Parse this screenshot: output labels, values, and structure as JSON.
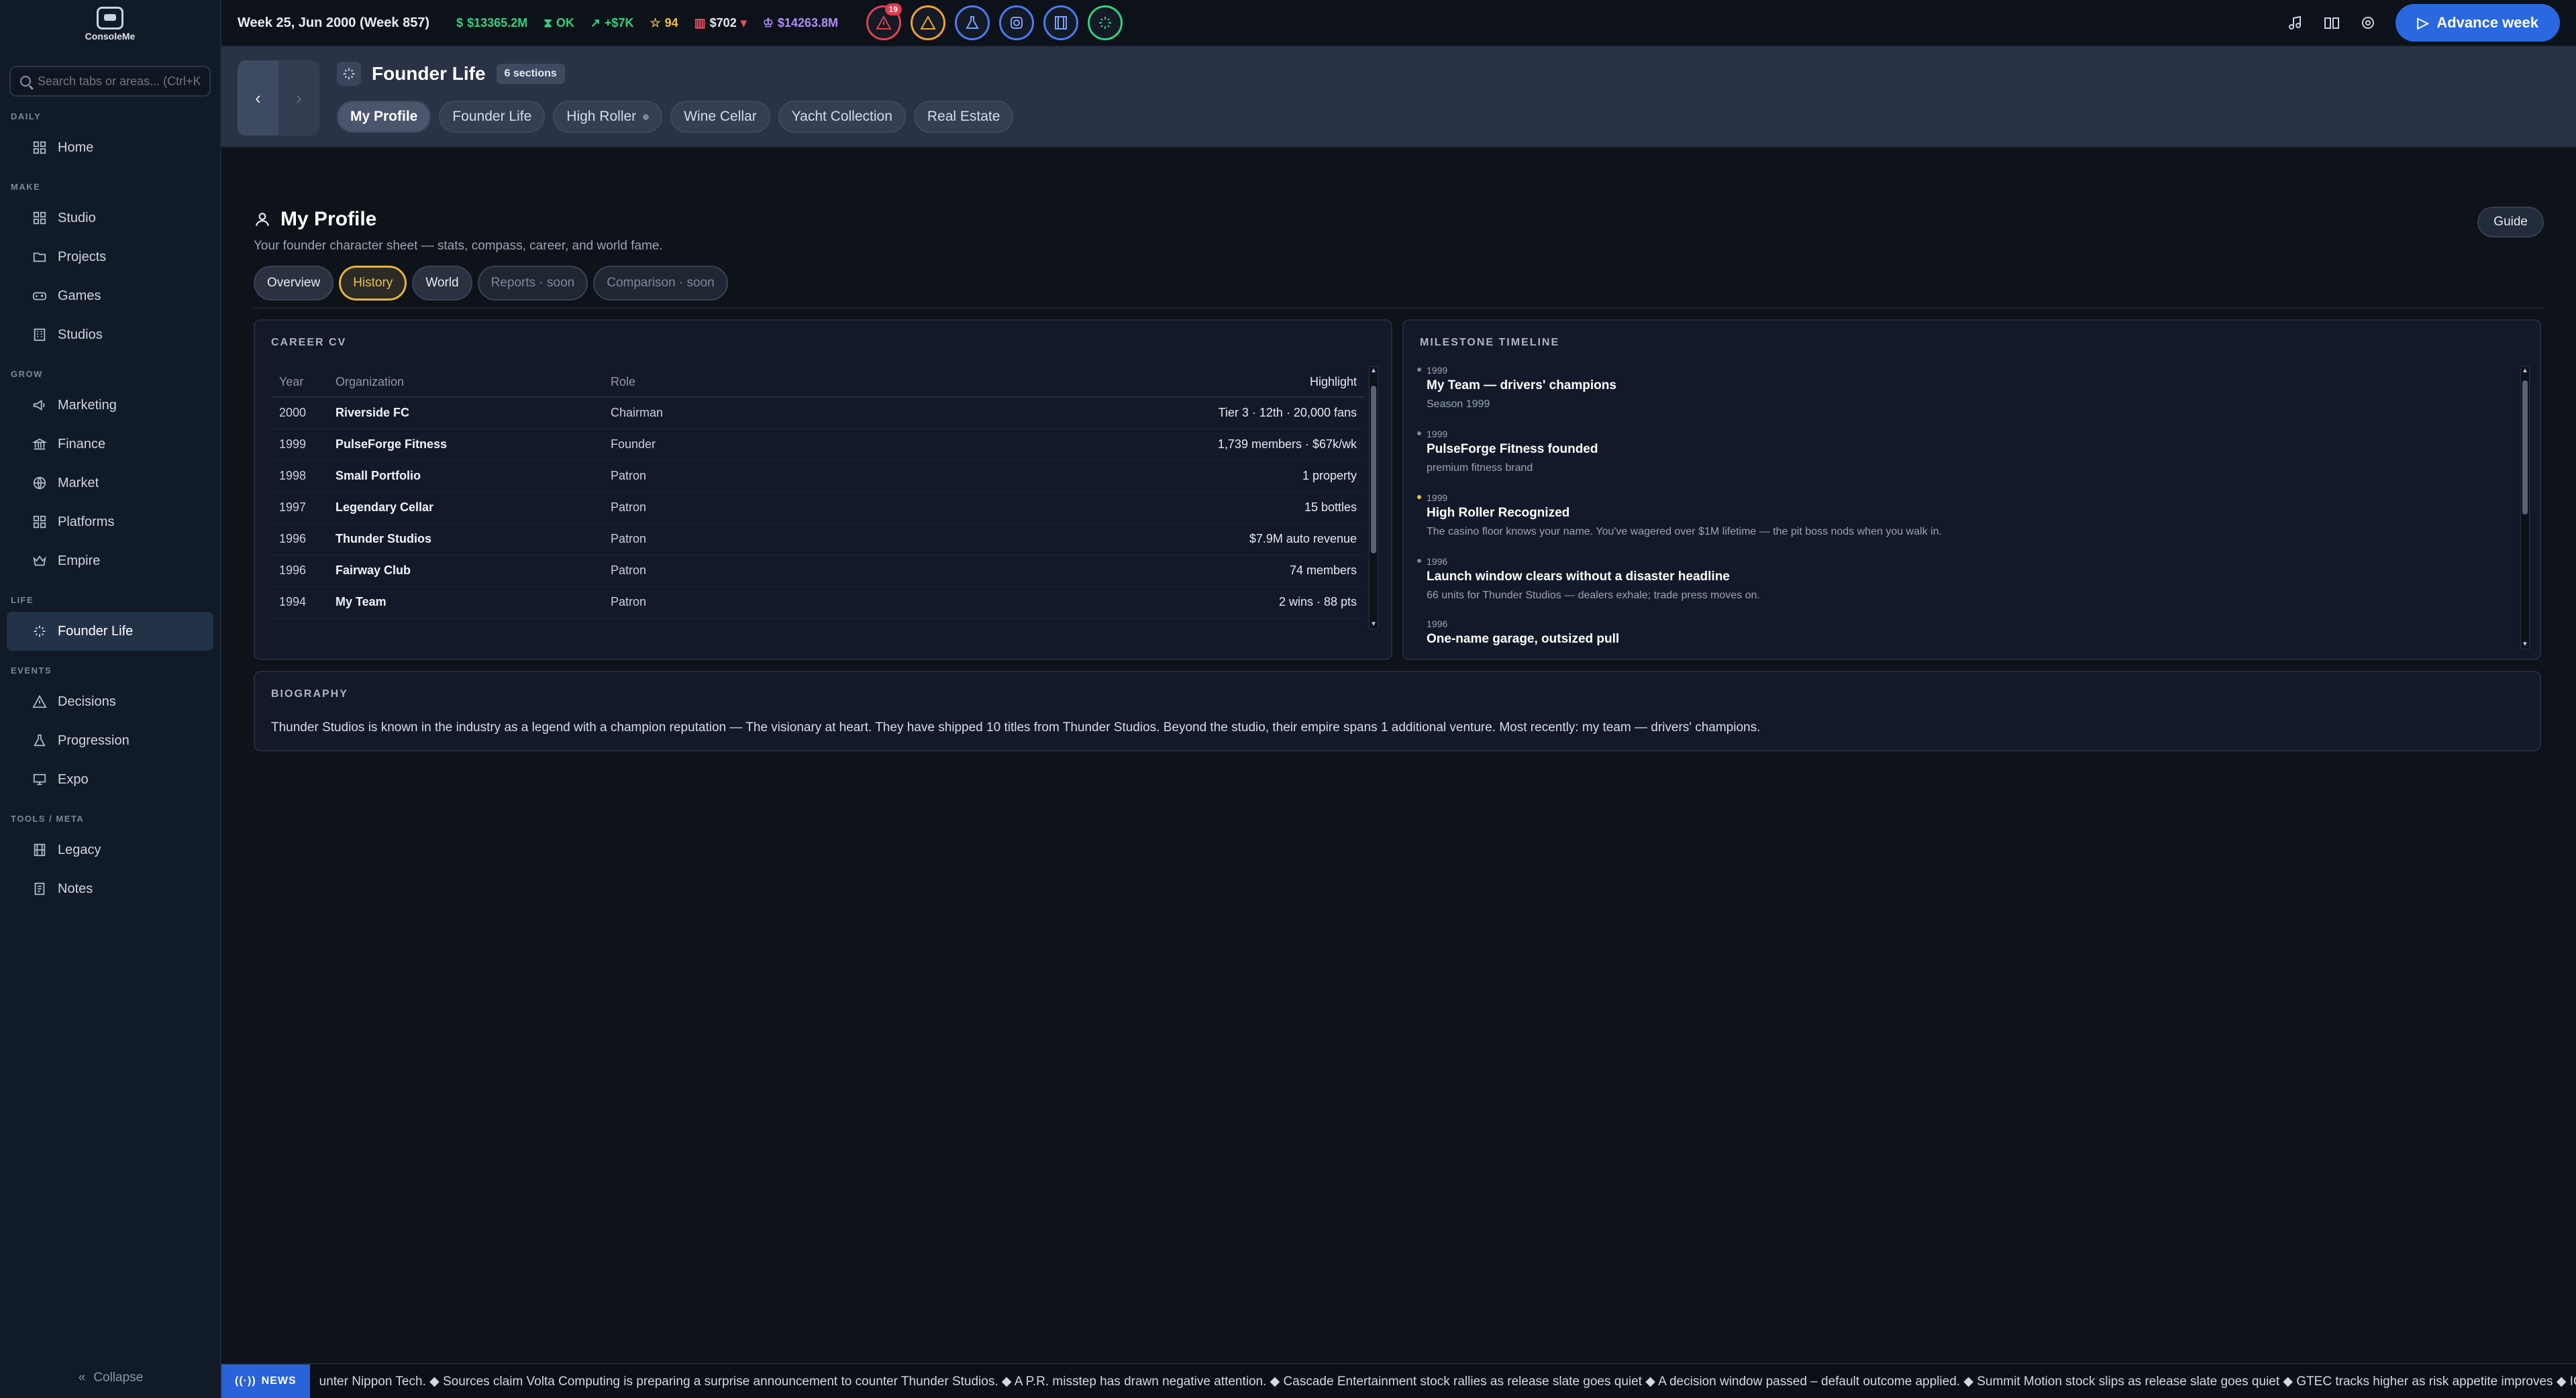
{
  "app": {
    "logo_text": "ConsoleMe"
  },
  "search": {
    "placeholder": "Search tabs or areas... (Ctrl+K)"
  },
  "sidebar": {
    "sections": [
      {
        "label": "DAILY",
        "items": [
          {
            "label": "Home",
            "icon": "grid-icon"
          }
        ]
      },
      {
        "label": "MAKE",
        "items": [
          {
            "label": "Studio",
            "icon": "grid-icon"
          },
          {
            "label": "Projects",
            "icon": "folder-icon"
          },
          {
            "label": "Games",
            "icon": "gamepad-icon"
          },
          {
            "label": "Studios",
            "icon": "building-icon"
          }
        ]
      },
      {
        "label": "GROW",
        "items": [
          {
            "label": "Marketing",
            "icon": "megaphone-icon"
          },
          {
            "label": "Finance",
            "icon": "bank-icon"
          },
          {
            "label": "Market",
            "icon": "globe-icon"
          },
          {
            "label": "Platforms",
            "icon": "grid-icon"
          },
          {
            "label": "Empire",
            "icon": "crown-icon"
          }
        ]
      },
      {
        "label": "LIFE",
        "items": [
          {
            "label": "Founder Life",
            "icon": "sparkle-icon",
            "active": true
          }
        ]
      },
      {
        "label": "EVENTS",
        "items": [
          {
            "label": "Decisions",
            "icon": "alert-icon"
          },
          {
            "label": "Progression",
            "icon": "flask-icon"
          },
          {
            "label": "Expo",
            "icon": "monitor-icon"
          }
        ]
      },
      {
        "label": "TOOLS / META",
        "items": [
          {
            "label": "Legacy",
            "icon": "film-icon"
          },
          {
            "label": "Notes",
            "icon": "notes-icon"
          }
        ]
      }
    ],
    "collapse_label": "Collapse"
  },
  "topbar": {
    "week": "Week 25, Jun 2000 (Week 857)",
    "cash": "$13365.2M",
    "status": "OK",
    "trend": "+$7K",
    "rep": "94",
    "price": "$702",
    "value": "$14263.8M",
    "alert_count": "19",
    "advance_label": "Advance week",
    "colors": {
      "green": "#35d07f",
      "yellow": "#f2c23a",
      "purple": "#b08cf7",
      "accent": "#2a68e0"
    }
  },
  "section": {
    "title": "Founder Life",
    "count": "6 sections",
    "tabs": [
      "My Profile",
      "Founder Life",
      "High Roller",
      "Wine Cellar",
      "Yacht Collection",
      "Real Estate"
    ]
  },
  "page": {
    "title": "My Profile",
    "subtitle": "Your founder character sheet — stats, compass, career, and world fame.",
    "guide_label": "Guide",
    "tabs": [
      "Overview",
      "History",
      "World",
      "Reports · soon",
      "Comparison · soon"
    ]
  },
  "career": {
    "title": "CAREER CV",
    "headers": [
      "Year",
      "Organization",
      "Role",
      "Highlight"
    ],
    "rows": [
      [
        "2000",
        "Riverside FC",
        "Chairman",
        "Tier 3 · 12th · 20,000 fans"
      ],
      [
        "1999",
        "PulseForge Fitness",
        "Founder",
        "1,739 members · $67k/wk"
      ],
      [
        "1998",
        "Small Portfolio",
        "Patron",
        "1 property"
      ],
      [
        "1997",
        "Legendary Cellar",
        "Patron",
        "15 bottles"
      ],
      [
        "1996",
        "Thunder Studios",
        "Patron",
        "$7.9M auto revenue"
      ],
      [
        "1996",
        "Fairway Club",
        "Patron",
        "74 members"
      ],
      [
        "1994",
        "My Team",
        "Patron",
        "2 wins · 88 pts"
      ]
    ]
  },
  "timeline": {
    "title": "MILESTONE TIMELINE",
    "items": [
      {
        "year": "1999",
        "title": "My Team — drivers' champions",
        "desc": "Season 1999"
      },
      {
        "year": "1999",
        "title": "PulseForge Fitness founded",
        "desc": "premium fitness brand"
      },
      {
        "year": "1999",
        "title": "High Roller Recognized",
        "desc": "The casino floor knows your name. You've wagered over $1M lifetime — the pit boss nods when you walk in."
      },
      {
        "year": "1996",
        "title": "Launch window clears without a disaster headline",
        "desc": "66 units for Thunder Studios — dealers exhale; trade press moves on."
      },
      {
        "year": "1996",
        "title": "One-name garage, outsized pull",
        "desc": ""
      }
    ]
  },
  "bio": {
    "title": "BIOGRAPHY",
    "text": "Thunder Studios is known in the industry as a legend with a champion reputation — The visionary at heart. They have shipped 10 titles from Thunder Studios. Beyond the studio, their empire spans 1 additional venture. Most recently: my team — drivers' champions."
  },
  "news": {
    "label": "NEWS",
    "text": "unter Nippon Tech. ◆ Sources claim Volta Computing is preparing a surprise announcement to counter Thunder Studios. ◆ A P.R. misstep has drawn negative attention. ◆ Cascade Entertainment stock rallies as release slate goes quiet ◆ A decision window passed – default outcome applied. ◆ Summit Motion stock slips as release slate goes quiet ◆ GTEC tracks higher as risk appetite improves ◆ IGI"
  }
}
